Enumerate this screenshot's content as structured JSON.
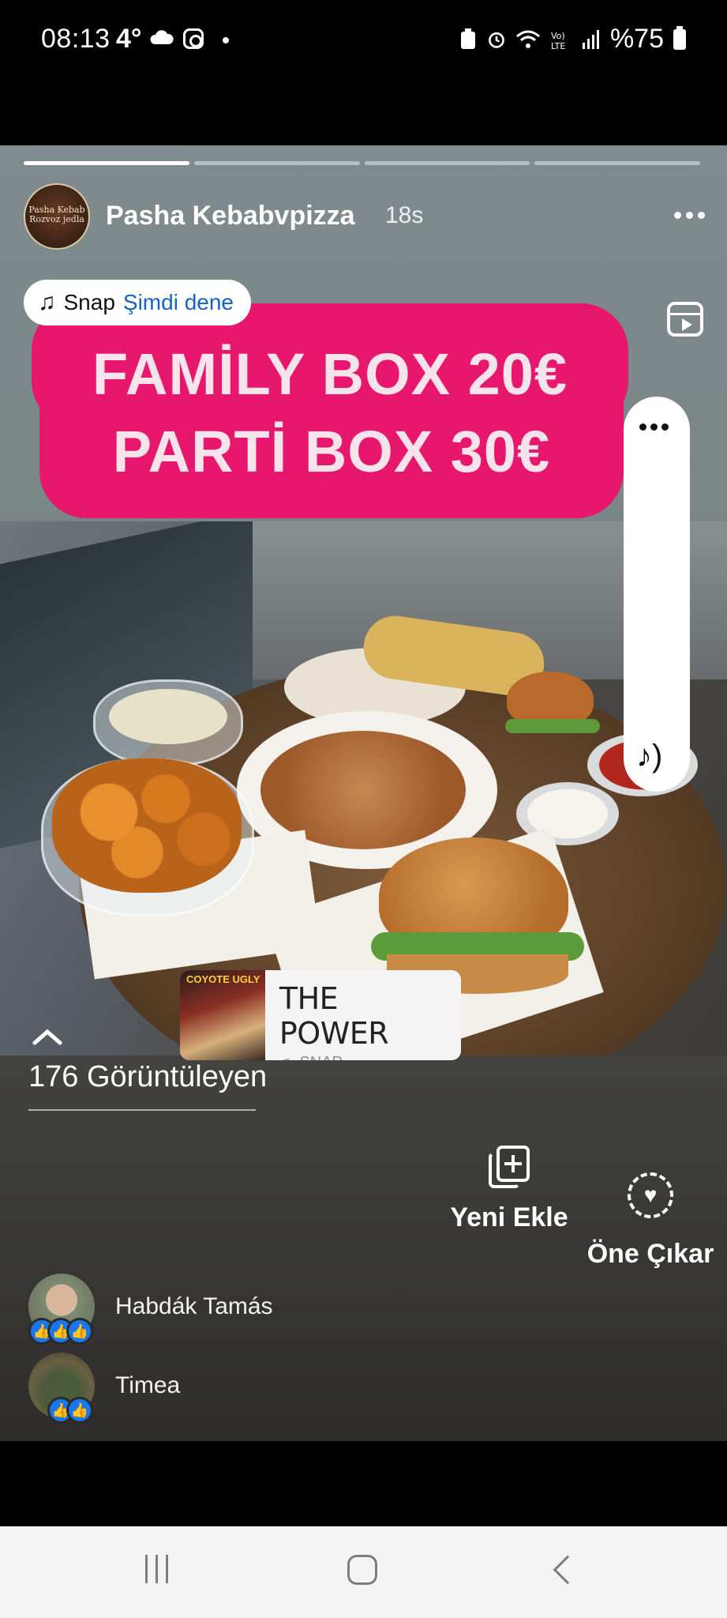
{
  "status_bar": {
    "time": "08:13",
    "temperature": "4°",
    "battery": "%75",
    "icons": [
      "cloud-icon",
      "instagram-icon",
      "battery-saver-icon",
      "alarm-icon",
      "wifi-icon",
      "volte-icon",
      "signal-icon",
      "battery-icon"
    ]
  },
  "story": {
    "progress_segments": 4,
    "active_segment": 1,
    "author": "Pasha Kebabvpizza",
    "time_ago": "18s",
    "avatar_text": "Pasha Kebab Rozvoz jedla",
    "snap_pill": {
      "label": "Snap",
      "action": "Şimdi dene"
    },
    "banner": {
      "line1": "FAMİLY BOX 20€",
      "line2": "PARTİ BOX 30€",
      "color": "#e6176c"
    },
    "music": {
      "title": "THE POWER",
      "artist": "SNAP",
      "album_label": "COYOTE UGLY"
    }
  },
  "viewers": {
    "count_label": "176 Görüntüleyen",
    "list": [
      {
        "name": "Habdák Tamás"
      },
      {
        "name": "Timea"
      }
    ]
  },
  "actions": {
    "add_label": "Yeni Ekle",
    "feature_label": "Öne Çıkar"
  },
  "colors": {
    "accent_link": "#1463c8",
    "like_blue": "#1877f2"
  }
}
